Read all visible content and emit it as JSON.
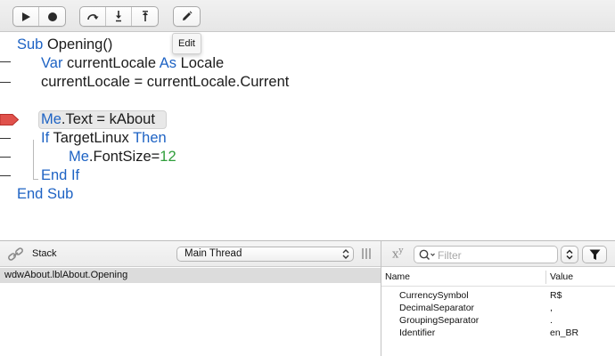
{
  "toolbar": {
    "run_icon": "play-icon",
    "stop_icon": "stop-icon",
    "step_over_icon": "step-over-icon",
    "step_in_icon": "step-in-icon",
    "step_out_icon": "step-out-icon",
    "edit_icon": "pencil-icon",
    "tooltip": "Edit"
  },
  "code": {
    "sub_kw": "Sub",
    "sub_name": "Opening()",
    "var_kw": "Var",
    "var_name": "currentLocale",
    "as_kw": "As",
    "type_name": "Locale",
    "assign_line": "currentLocale = currentLocale.Current",
    "me_kw": "Me",
    "me_text_rest": ".Text = kAbout",
    "if_kw": "If",
    "if_cond": "TargetLinux",
    "then_kw": "Then",
    "me_kw2": "Me",
    "fontsize_rest": ".FontSize=",
    "fontsize_val": "12",
    "end_if": "End If",
    "end_sub": "End Sub"
  },
  "stack": {
    "label": "Stack",
    "thread": "Main Thread",
    "frames": [
      "wdwAbout.lblAbout.Opening"
    ]
  },
  "variables": {
    "filter_placeholder": "Filter",
    "columns": {
      "name": "Name",
      "value": "Value"
    },
    "rows": [
      {
        "name": "CurrencySymbol",
        "value": "R$"
      },
      {
        "name": "DecimalSeparator",
        "value": ","
      },
      {
        "name": "GroupingSeparator",
        "value": "."
      },
      {
        "name": "Identifier",
        "value": "en_BR"
      }
    ]
  },
  "colors": {
    "keyword": "#1e63c4",
    "number": "#2f9e3a",
    "breakpoint": "#e0514b"
  }
}
